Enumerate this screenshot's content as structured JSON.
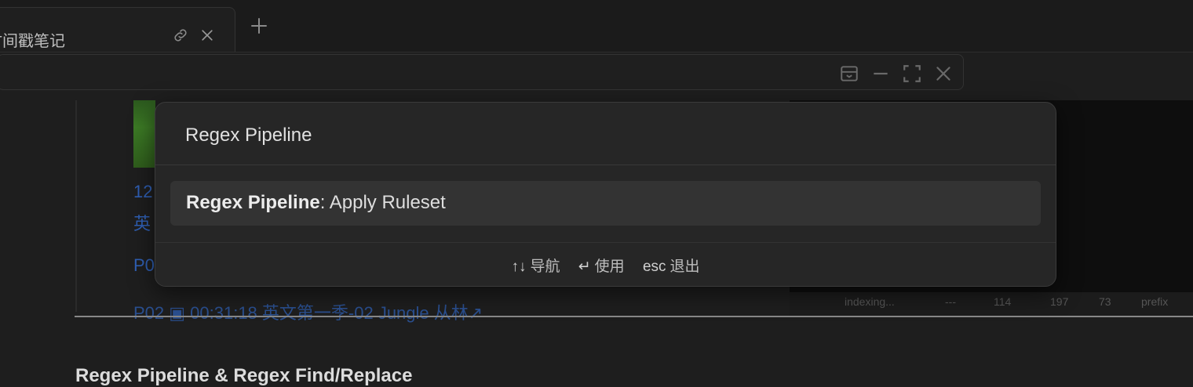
{
  "tab": {
    "title": "时间戳笔记",
    "link_icon": "link-icon",
    "close_icon": "close-icon"
  },
  "tabbar": {
    "new_tab_icon": "plus-icon"
  },
  "view_header": {
    "icons": [
      "inbox-icon",
      "minimize-icon",
      "fullscreen-icon",
      "close-icon"
    ]
  },
  "document": {
    "lines": [
      {
        "text": "12"
      },
      {
        "text": "英"
      },
      {
        "text": "P0"
      },
      {
        "text": "P02 ▣ 00:31:18 英文第一季-02 Jungle 从林↗"
      }
    ],
    "heading": "Regex Pipeline & Regex Find/Replace"
  },
  "statusbar": {
    "items": [
      {
        "text": "indexing..."
      },
      {
        "text": "---"
      },
      {
        "text": "114"
      },
      {
        "text": "197"
      },
      {
        "text": "73"
      },
      {
        "text": "prefix"
      }
    ]
  },
  "palette": {
    "query": "Regex Pipeline",
    "suggestion": {
      "match": "Regex Pipeline",
      "rest": ": Apply Ruleset"
    },
    "instructions": [
      {
        "key": "↑↓",
        "label": "导航"
      },
      {
        "key": "↵",
        "label": "使用"
      },
      {
        "key": "esc",
        "label": "退出"
      }
    ]
  },
  "colors": {
    "background": "#1e1e1e",
    "modal": "#262626",
    "selected": "#333333",
    "link": "#2f5fb3"
  }
}
